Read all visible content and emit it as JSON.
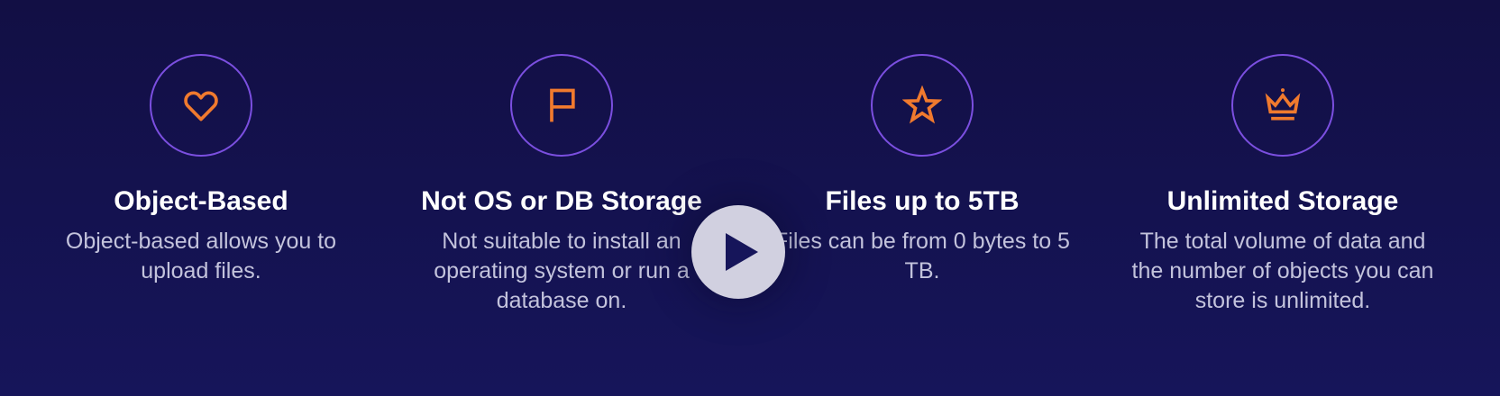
{
  "features": [
    {
      "title": "Object-Based",
      "description": "Object-based allows you to upload files.",
      "icon": "heart-icon"
    },
    {
      "title": "Not OS or DB Storage",
      "description": "Not suitable to install an operating system or run a database on.",
      "icon": "flag-icon"
    },
    {
      "title": "Files up to 5TB",
      "description": "Files can be from 0 bytes to 5 TB.",
      "icon": "star-icon"
    },
    {
      "title": "Unlimited Storage",
      "description": "The total volume of data and the number of objects you can store is unlimited.",
      "icon": "crown-icon"
    }
  ],
  "video": {
    "control": "play-icon"
  },
  "colors": {
    "background": "#120f44",
    "icon_accent": "#f07a2e",
    "circle_border": "#7b4fe0",
    "title_text": "#ffffff",
    "body_text": "#c3c3dc",
    "play_button": "#d1d0e0"
  }
}
